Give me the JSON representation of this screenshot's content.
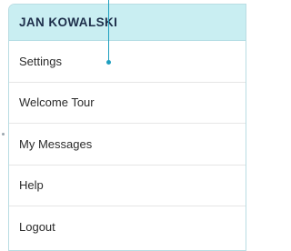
{
  "menu": {
    "title": "JAN KOWALSKI",
    "items": [
      {
        "label": "Settings"
      },
      {
        "label": "Welcome Tour"
      },
      {
        "label": "My Messages"
      },
      {
        "label": "Help"
      },
      {
        "label": "Logout"
      }
    ]
  },
  "colors": {
    "header_background": "#c9eef2",
    "border": "#b9dde3",
    "title_text": "#1d2e4a",
    "item_text": "#2b2b2b",
    "pointer": "#1e9fbf"
  }
}
